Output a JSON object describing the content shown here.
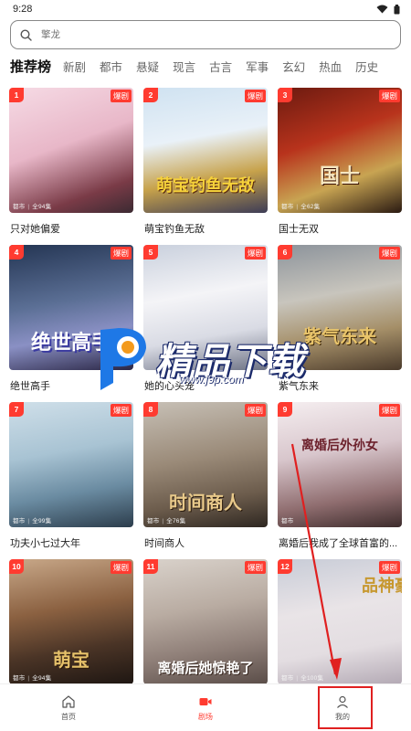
{
  "status": {
    "time": "9:28"
  },
  "search": {
    "placeholder": "擎龙"
  },
  "tabs": [
    "推荐榜",
    "新剧",
    "都市",
    "悬疑",
    "现言",
    "古言",
    "军事",
    "玄幻",
    "热血",
    "历史"
  ],
  "cards": [
    {
      "rank": "1",
      "badge": "爆剧",
      "meta_genre": "都市",
      "meta_count": "全94集",
      "poster_text": "",
      "title": "只对她偏爱"
    },
    {
      "rank": "2",
      "badge": "爆剧",
      "meta_genre": "",
      "meta_count": "",
      "poster_text": "萌宝钓鱼无敌",
      "title": "萌宝钓鱼无敌"
    },
    {
      "rank": "3",
      "badge": "爆剧",
      "meta_genre": "都市",
      "meta_count": "全62集",
      "poster_text": "国士",
      "title": "国士无双"
    },
    {
      "rank": "4",
      "badge": "爆剧",
      "meta_genre": "",
      "meta_count": "",
      "poster_text": "绝世高手",
      "title": "绝世高手"
    },
    {
      "rank": "5",
      "badge": "爆剧",
      "meta_genre": "",
      "meta_count": "",
      "poster_text": "",
      "title": "她的心头宠"
    },
    {
      "rank": "6",
      "badge": "爆剧",
      "meta_genre": "",
      "meta_count": "",
      "poster_text": "紫气东来",
      "title": "紫气东来"
    },
    {
      "rank": "7",
      "badge": "爆剧",
      "meta_genre": "都市",
      "meta_count": "全99集",
      "poster_text": "",
      "title": "功夫小七过大年"
    },
    {
      "rank": "8",
      "badge": "爆剧",
      "meta_genre": "都市",
      "meta_count": "全76集",
      "poster_text": "时间商人",
      "title": "时间商人"
    },
    {
      "rank": "9",
      "badge": "爆剧",
      "meta_genre": "都市",
      "meta_count": "",
      "poster_text": "离婚后外孙女",
      "title": "离婚后我成了全球首富的..."
    },
    {
      "rank": "10",
      "badge": "爆剧",
      "meta_genre": "都市",
      "meta_count": "全94集",
      "poster_text": "萌宝",
      "title": ""
    },
    {
      "rank": "11",
      "badge": "爆剧",
      "meta_genre": "",
      "meta_count": "",
      "poster_text": "离婚后她惊艳了",
      "title": ""
    },
    {
      "rank": "12",
      "badge": "爆剧",
      "meta_genre": "都市",
      "meta_count": "全100集",
      "poster_text": "品神豪",
      "title": ""
    }
  ],
  "nav": {
    "home": "首页",
    "theater": "剧场",
    "mine": "我的"
  },
  "watermark": {
    "text": "精品下载",
    "url": "www.j9p.com"
  },
  "colors": {
    "accent": "#ff3b30",
    "annotation": "#e02020"
  }
}
